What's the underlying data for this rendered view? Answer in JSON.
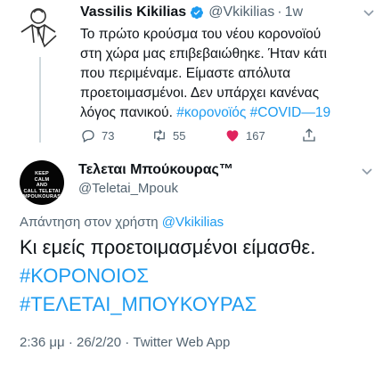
{
  "tweet": {
    "author_name": "Vassilis Kikilias",
    "handle": "@Vkikilias",
    "separator": "·",
    "time": "1w",
    "body_line1": "Το πρώτο κρούσμα του νέου κορονοϊού",
    "body_line2": "στη χώρα μας επιβεβαιώθηκε. Ήταν κάτι",
    "body_line3": "που περιμέναμε. Είμαστε απόλυτα",
    "body_line4": "προετοιμασμένοι. Δεν υπάρχει κανένας",
    "body_line5_text": "λόγος πανικού.",
    "hashtag1": "#κορονοϊός",
    "hashtag2": "#COVID—19",
    "replies": "73",
    "retweets": "55",
    "likes": "167",
    "like_color": "#e0245e"
  },
  "reply": {
    "author_name": "Τελεται Μπούκουρας™",
    "handle": "@Teletai_Mpouk",
    "avatar_text": [
      "KEEP",
      "CALM",
      "AND",
      "CALL TELETAI",
      "MPOUKOURAS"
    ],
    "replying_prefix": "Απάντηση στον χρήστη",
    "replying_to": "@Vkikilias",
    "body_line1": "Κι εμείς προετοιμασμένοι είμασθε.",
    "body_line2": "#ΚΟΡΟΝΟΙΟΣ",
    "body_line3": "#ΤΕΛΕΤΑΙ_ΜΠΟΥΚΟΥΡΑΣ",
    "time": "2:36 μμ",
    "separator": "·",
    "date": "26/2/20",
    "source_prefix": "·",
    "source": "Twitter Web App"
  },
  "icons": {
    "verified": "verified-badge-icon",
    "more": "chevron-down-icon",
    "reply": "reply-bubble-icon",
    "retweet": "retweet-icon",
    "like": "heart-icon",
    "share": "share-icon"
  }
}
